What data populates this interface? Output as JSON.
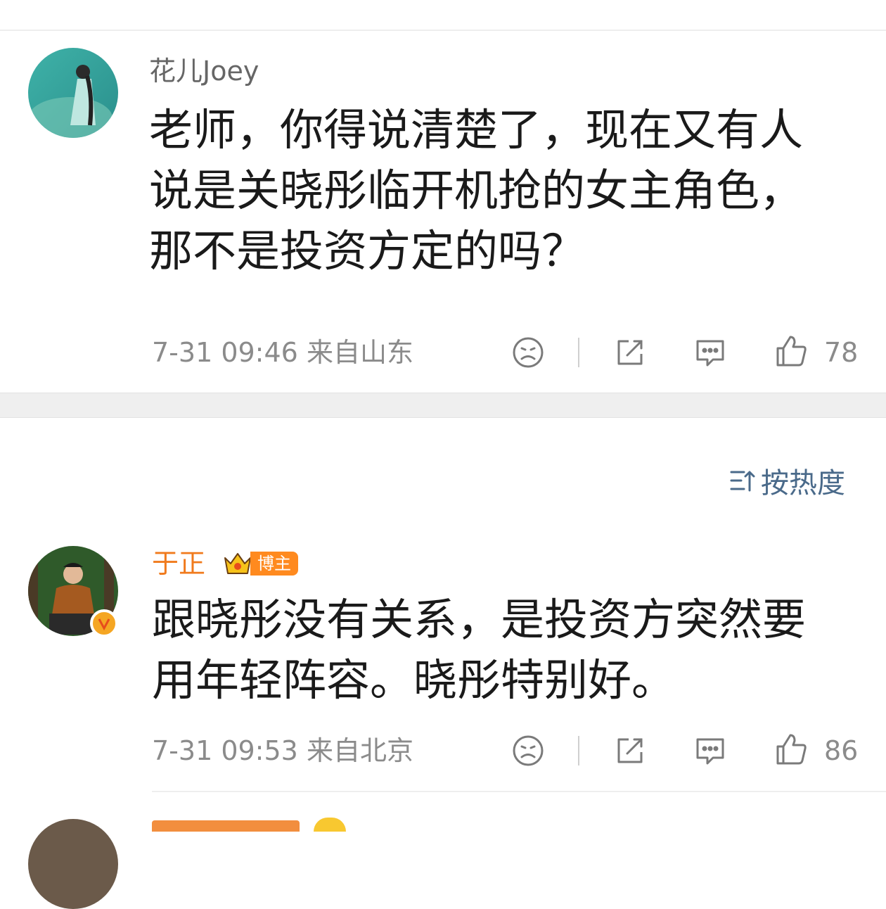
{
  "comments": [
    {
      "username": "花儿Joey",
      "text": "老师，你得说清楚了，现在又有人说是关晓彤临开机抢的女主角色，那不是投资方定的吗？",
      "time": "7-31 09:46",
      "location": "来自山东",
      "likes": "78",
      "icons": [
        "sad-face-icon",
        "share-icon",
        "comment-icon",
        "thumbs-up-icon"
      ]
    },
    {
      "username": "于正",
      "badge": "博主",
      "text": "跟晓彤没有关系，是投资方突然要用年轻阵容。晓彤特别好。",
      "time": "7-31 09:53",
      "location": "来自北京",
      "likes": "86",
      "icons": [
        "sad-face-icon",
        "share-icon",
        "comment-icon",
        "thumbs-up-icon"
      ]
    }
  ],
  "sort": {
    "label": "按热度",
    "icon": "sort-icon"
  },
  "colors": {
    "username_default": "#666666",
    "username_verified": "#f07a1c",
    "meta": "#8b8b8b",
    "sort": "#4a6a8a",
    "badge": "#ff8a1f"
  }
}
